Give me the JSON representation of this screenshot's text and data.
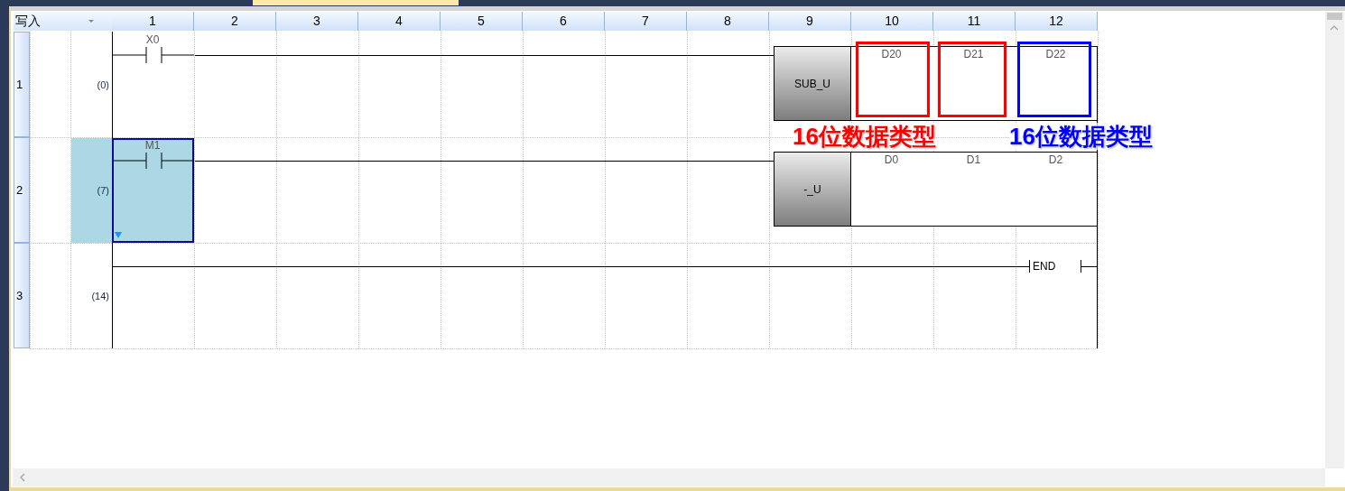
{
  "editor_mode": "写入",
  "columns": [
    "1",
    "2",
    "3",
    "4",
    "5",
    "6",
    "7",
    "8",
    "9",
    "10",
    "11",
    "12"
  ],
  "rungs": [
    {
      "row": "1",
      "step": "(0)",
      "selected": false,
      "contact": "X0",
      "instruction": {
        "kind": "box",
        "name": "SUB_U",
        "operands": [
          {
            "device": "D20",
            "color": "#ff0000"
          },
          {
            "device": "D21",
            "color": "#ff0000"
          },
          {
            "device": "D22",
            "color": "#0000ff"
          }
        ]
      }
    },
    {
      "row": "2",
      "step": "(7)",
      "selected": true,
      "contact": "M1",
      "instruction": {
        "kind": "box",
        "name": "-_U",
        "operands": [
          {
            "device": "D0"
          },
          {
            "device": "D1"
          },
          {
            "device": "D2"
          }
        ]
      }
    },
    {
      "row": "3",
      "step": "(14)",
      "selected": false,
      "instruction": {
        "kind": "end",
        "name": "END"
      }
    }
  ],
  "annotations": [
    {
      "text": "16位数据类型",
      "color": "#ff0000"
    },
    {
      "text": "16位数据类型",
      "color": "#0000ff"
    }
  ]
}
